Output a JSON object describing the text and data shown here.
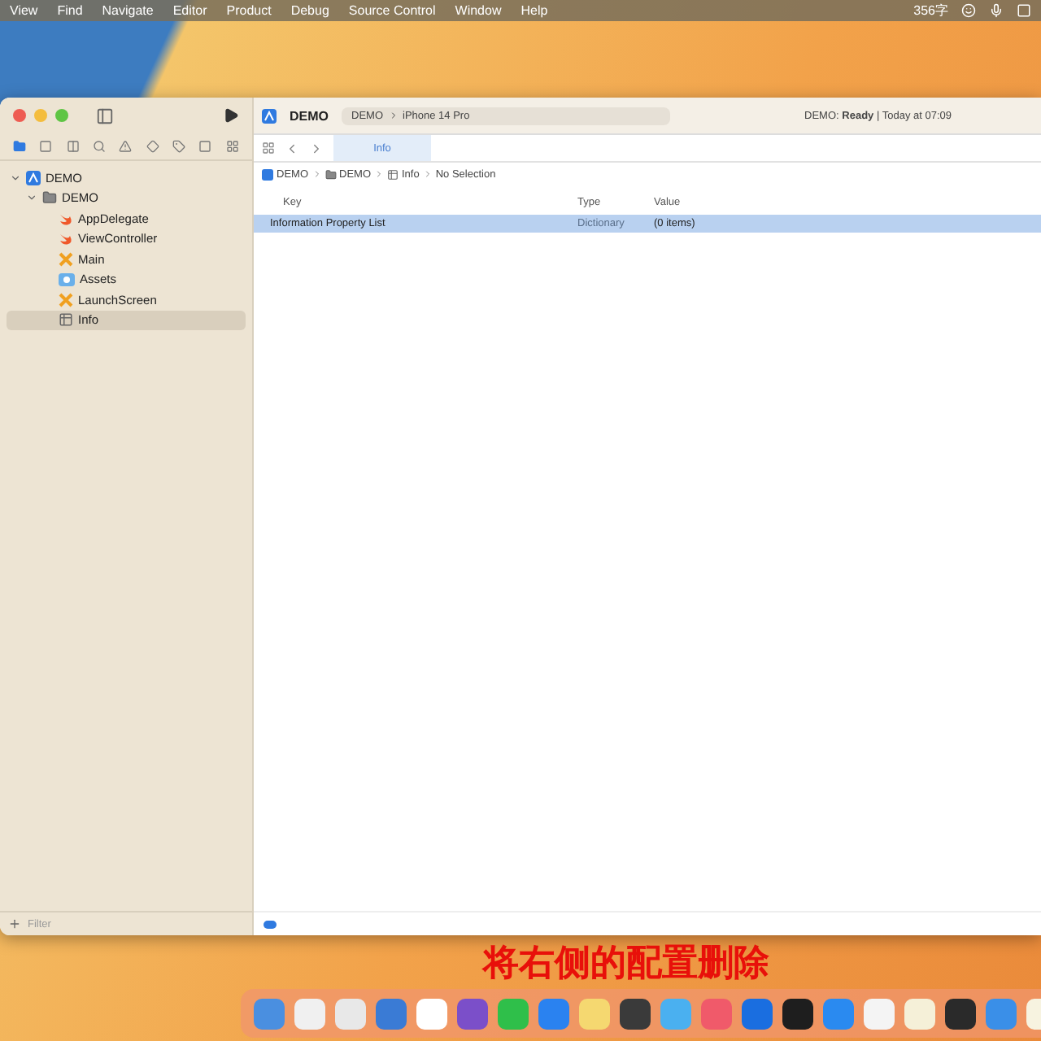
{
  "menu_bar": {
    "items": [
      "View",
      "Find",
      "Navigate",
      "Editor",
      "Product",
      "Debug",
      "Source Control",
      "Window",
      "Help"
    ],
    "word_count": "356字"
  },
  "window": {
    "project_title": "DEMO",
    "scheme": {
      "target": "DEMO",
      "device": "iPhone 14 Pro"
    },
    "status": "DEMO: **Ready** | Today at 07:09",
    "navigator_tabs": [
      {
        "kind": "folder",
        "selected": true
      },
      {
        "kind": "source",
        "selected": false
      },
      {
        "kind": "symbols",
        "selected": false
      },
      {
        "kind": "search",
        "selected": false
      },
      {
        "kind": "issues",
        "selected": false
      },
      {
        "kind": "tests",
        "selected": false
      },
      {
        "kind": "debug",
        "selected": false
      },
      {
        "kind": "breakpoints",
        "selected": false
      },
      {
        "kind": "reports",
        "selected": false
      }
    ],
    "tree": [
      {
        "label": "DEMO",
        "kind": "project",
        "expanded": true,
        "selected": false,
        "children": [
          {
            "label": "DEMO",
            "kind": "folder",
            "expanded": true,
            "selected": false,
            "children": [
              {
                "label": "AppDelegate",
                "kind": "swift",
                "selected": false
              },
              {
                "label": "ViewController",
                "kind": "swift",
                "selected": false
              },
              {
                "label": "Main",
                "kind": "storyboard",
                "selected": false
              },
              {
                "label": "Assets",
                "kind": "assets",
                "selected": false
              },
              {
                "label": "LaunchScreen",
                "kind": "storyboard",
                "selected": false
              },
              {
                "label": "Info",
                "kind": "plist",
                "selected": true
              }
            ]
          }
        ]
      }
    ],
    "filter": {
      "placeholder": "Filter"
    },
    "editor_tabs": [
      {
        "label": "Info",
        "selected": true
      }
    ],
    "breadcrumb": [
      {
        "label": "DEMO",
        "kind": "project"
      },
      {
        "label": "DEMO",
        "kind": "folder"
      },
      {
        "label": "Info",
        "kind": "plist"
      },
      {
        "label": "No Selection",
        "kind": "none"
      }
    ],
    "table": {
      "columns": [
        "Key",
        "Type",
        "Value"
      ],
      "rows": [
        {
          "key": "Information Property List",
          "type": "Dictionary",
          "value": "(0 items)",
          "selected": true
        }
      ]
    }
  },
  "caption": "将右侧的配置删除",
  "dock": {
    "apps": [
      {
        "color": "#4a8fe0"
      },
      {
        "color": "#f0f0f0"
      },
      {
        "color": "#e8e8e8"
      },
      {
        "color": "#3a7bd5"
      },
      {
        "color": "#ffffff"
      },
      {
        "color": "#7b4fc9"
      },
      {
        "color": "#2fbf4a"
      },
      {
        "color": "#2a82f0"
      },
      {
        "color": "#f5d870"
      },
      {
        "color": "#3a3a3a"
      },
      {
        "color": "#4ab0f0"
      },
      {
        "color": "#f05a6a"
      },
      {
        "color": "#1a6ee0"
      },
      {
        "color": "#1e1e1e"
      },
      {
        "color": "#2a8af0"
      },
      {
        "color": "#f4f4f4"
      },
      {
        "color": "#f5f0d8"
      },
      {
        "color": "#2a2a2a"
      },
      {
        "color": "#3a8fe8"
      },
      {
        "color": "#f7f3e0"
      }
    ]
  }
}
